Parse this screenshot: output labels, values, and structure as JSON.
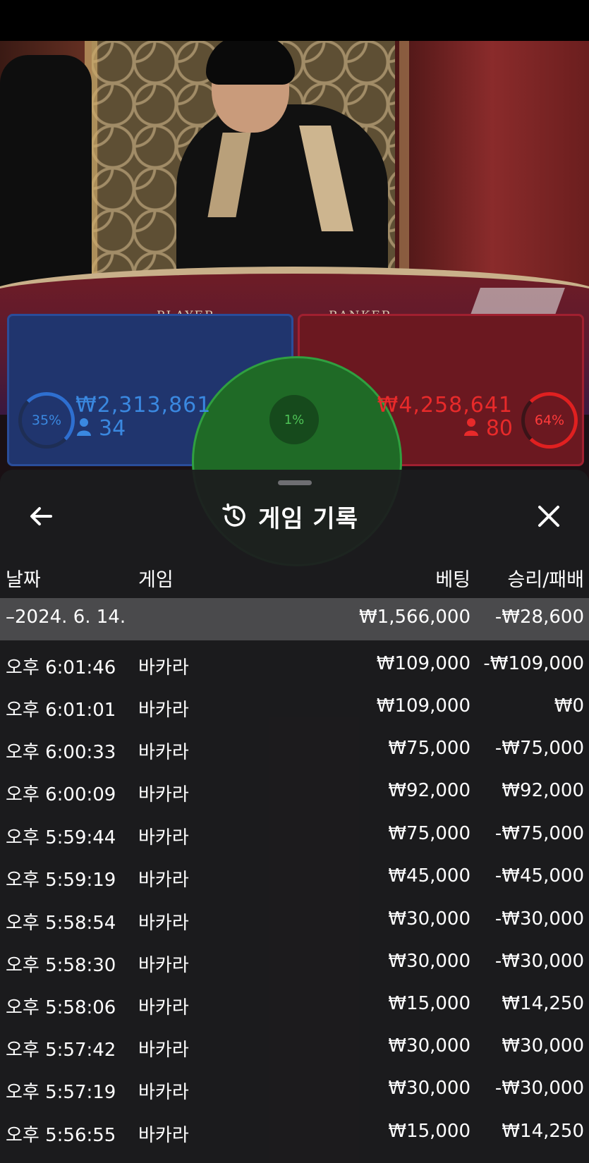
{
  "background": {
    "table_labels": [
      "PLAYER",
      "BANKER"
    ],
    "player": {
      "percent": "35%",
      "amount": "₩2,313,861",
      "count": "34"
    },
    "banker": {
      "percent": "64%",
      "amount": "₩4,258,641",
      "count": "80"
    },
    "tie": {
      "percent": "1%"
    }
  },
  "sheet": {
    "title": "게임 기록",
    "columns": {
      "date": "날짜",
      "game": "게임",
      "bet": "베팅",
      "result": "승리/패배"
    },
    "summary": {
      "date": "–2024. 6. 14.",
      "bet": "₩1,566,000",
      "result": "-₩28,600"
    },
    "rows": [
      {
        "time": "오후 6:01:46",
        "game": "바카라",
        "bet": "₩109,000",
        "result": "-₩109,000"
      },
      {
        "time": "오후 6:01:01",
        "game": "바카라",
        "bet": "₩109,000",
        "result": "₩0"
      },
      {
        "time": "오후 6:00:33",
        "game": "바카라",
        "bet": "₩75,000",
        "result": "-₩75,000"
      },
      {
        "time": "오후 6:00:09",
        "game": "바카라",
        "bet": "₩92,000",
        "result": "₩92,000"
      },
      {
        "time": "오후 5:59:44",
        "game": "바카라",
        "bet": "₩75,000",
        "result": "-₩75,000"
      },
      {
        "time": "오후 5:59:19",
        "game": "바카라",
        "bet": "₩45,000",
        "result": "-₩45,000"
      },
      {
        "time": "오후 5:58:54",
        "game": "바카라",
        "bet": "₩30,000",
        "result": "-₩30,000"
      },
      {
        "time": "오후 5:58:30",
        "game": "바카라",
        "bet": "₩30,000",
        "result": "-₩30,000"
      },
      {
        "time": "오후 5:58:06",
        "game": "바카라",
        "bet": "₩15,000",
        "result": "₩14,250"
      },
      {
        "time": "오후 5:57:42",
        "game": "바카라",
        "bet": "₩30,000",
        "result": "₩30,000"
      },
      {
        "time": "오후 5:57:19",
        "game": "바카라",
        "bet": "₩30,000",
        "result": "-₩30,000"
      },
      {
        "time": "오후 5:56:55",
        "game": "바카라",
        "bet": "₩15,000",
        "result": "₩14,250"
      }
    ]
  },
  "icons": {
    "back": "arrow-left-icon",
    "history": "history-icon",
    "close": "close-icon",
    "person": "person-icon"
  },
  "colors": {
    "player_blue": "#3a88e0",
    "banker_red": "#e82a2a",
    "tie_green": "#4ec256",
    "sheet_bg": "#1c1c1e",
    "summary_row": "#4a4a4c"
  }
}
